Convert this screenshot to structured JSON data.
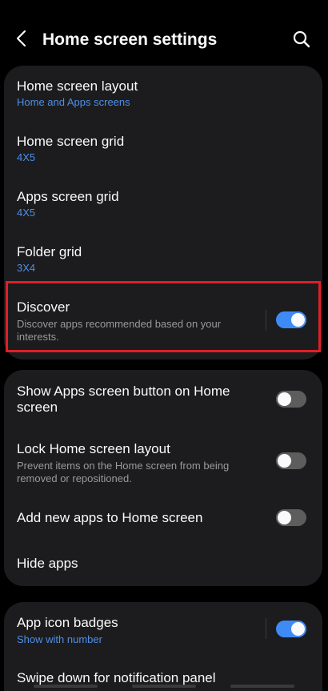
{
  "header": {
    "title": "Home screen settings",
    "back_icon": "chevron-left-icon",
    "search_icon": "search-icon"
  },
  "card1": {
    "home_layout": {
      "title": "Home screen layout",
      "value": "Home and Apps screens"
    },
    "home_grid": {
      "title": "Home screen grid",
      "value": "4X5"
    },
    "apps_grid": {
      "title": "Apps screen grid",
      "value": "4X5"
    },
    "folder_grid": {
      "title": "Folder grid",
      "value": "3X4"
    },
    "discover": {
      "title": "Discover",
      "description": "Discover apps recommended based on your interests.",
      "enabled": true
    }
  },
  "card2": {
    "show_apps_button": {
      "title": "Show Apps screen button on Home screen",
      "enabled": false
    },
    "lock_layout": {
      "title": "Lock Home screen layout",
      "description": "Prevent items on the Home screen from being removed or repositioned.",
      "enabled": false
    },
    "add_new_apps": {
      "title": "Add new apps to Home screen",
      "enabled": false
    },
    "hide_apps": {
      "title": "Hide apps"
    }
  },
  "card3": {
    "app_icon_badges": {
      "title": "App icon badges",
      "value": "Show with number",
      "enabled": true
    },
    "swipe_down": {
      "title": "Swipe down for notification panel"
    }
  },
  "colors": {
    "accent": "#3e8bf5",
    "link": "#4d8fe7",
    "background": "#000000",
    "card": "#1c1c1e",
    "highlight": "#e01f26"
  }
}
